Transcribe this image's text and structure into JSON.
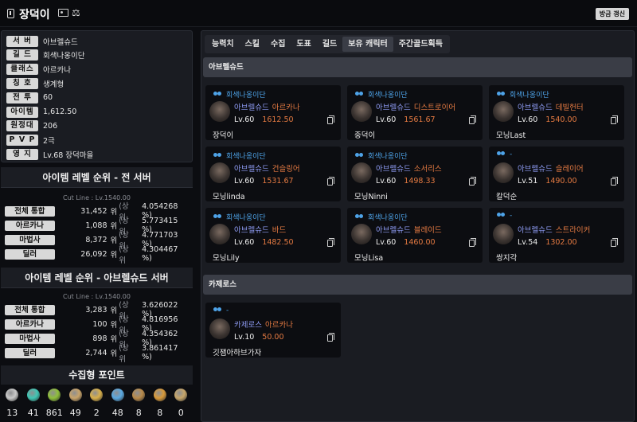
{
  "header": {
    "name": "장덕이",
    "refresh_label": "방금 갱신"
  },
  "info": [
    {
      "label": "서 버",
      "value": "아브렐슈드"
    },
    {
      "label": "길 드",
      "value": "회색나옹이단"
    },
    {
      "label": "클래스",
      "value": "아르카나"
    },
    {
      "label": "칭 호",
      "value": "생계형"
    },
    {
      "label": "전 투",
      "value": "60"
    },
    {
      "label": "아이템",
      "value": "1,612.50"
    },
    {
      "label": "원정대",
      "value": "206"
    },
    {
      "label": "P V P",
      "value": "2극"
    },
    {
      "label": "영 지",
      "value": "Lv.68 장덕마을"
    }
  ],
  "rank_all": {
    "title": "아이템 레벨 순위 - 전 서버",
    "cutline": "Cut Line : Lv.1540.00",
    "rows": [
      {
        "label": "전체 통합",
        "num": "31,452",
        "unit": "위",
        "upper": "(상위",
        "pct": "4.054268 %)"
      },
      {
        "label": "아르카나",
        "num": "1,088",
        "unit": "위",
        "upper": "(상위",
        "pct": "5.773415 %)"
      },
      {
        "label": "마법사",
        "num": "8,372",
        "unit": "위",
        "upper": "(상위",
        "pct": "4.771703 %)"
      },
      {
        "label": "딜러",
        "num": "26,092",
        "unit": "위",
        "upper": "(상위",
        "pct": "4.304467 %)"
      }
    ]
  },
  "rank_server": {
    "title": "아이템 레벨 순위 - 아브렐슈드 서버",
    "cutline": "Cut Line : Lv.1540.00",
    "rows": [
      {
        "label": "전체 통합",
        "num": "3,283",
        "unit": "위",
        "upper": "(상위",
        "pct": "3.626022 %)"
      },
      {
        "label": "아르카나",
        "num": "100",
        "unit": "위",
        "upper": "(상위",
        "pct": "4.816956 %)"
      },
      {
        "label": "마법사",
        "num": "898",
        "unit": "위",
        "upper": "(상위",
        "pct": "4.354362 %)"
      },
      {
        "label": "딜러",
        "num": "2,744",
        "unit": "위",
        "upper": "(상위",
        "pct": "3.861417 %)"
      }
    ]
  },
  "collection": {
    "title": "수집형 포인트",
    "items": [
      {
        "icon": "giant-heart-icon",
        "count": "13",
        "color": "#c9c9c9"
      },
      {
        "icon": "island-heart-icon",
        "count": "41",
        "color": "#3fc7b5"
      },
      {
        "icon": "mokoko-seed-icon",
        "count": "861",
        "color": "#8fbf3a"
      },
      {
        "icon": "art-icon",
        "count": "49",
        "color": "#c9a46a"
      },
      {
        "icon": "voyage-icon",
        "count": "2",
        "color": "#d9b04a"
      },
      {
        "icon": "world-tree-leaf-icon",
        "count": "48",
        "color": "#5aa8e0"
      },
      {
        "icon": "ignea-token-icon",
        "count": "8",
        "color": "#b88a4a"
      },
      {
        "icon": "orpheus-star-icon",
        "count": "8",
        "color": "#d99a3a"
      },
      {
        "icon": "orgel-icon",
        "count": "0",
        "color": "#c7a66a"
      }
    ]
  },
  "tabs": [
    {
      "label": "능력치",
      "active": false
    },
    {
      "label": "스킬",
      "active": false
    },
    {
      "label": "수집",
      "active": false
    },
    {
      "label": "도표",
      "active": false
    },
    {
      "label": "길드",
      "active": false
    },
    {
      "label": "보유 캐릭터",
      "active": true
    },
    {
      "label": "주간골드획득",
      "active": false
    }
  ],
  "groups": [
    {
      "name": "아브렐슈드",
      "characters": [
        {
          "guild": "회색나옹이단",
          "server": "아브렐슈드",
          "class": "아르카나",
          "level": "Lv.60",
          "ilvl": "1612.50",
          "name": "장덕이"
        },
        {
          "guild": "회색나옹이단",
          "server": "아브렐슈드",
          "class": "디스트로이어",
          "level": "Lv.60",
          "ilvl": "1561.67",
          "name": "중덕이"
        },
        {
          "guild": "회색나옹이단",
          "server": "아브렐슈드",
          "class": "데빌헌터",
          "level": "Lv.60",
          "ilvl": "1540.00",
          "name": "모닝Last"
        },
        {
          "guild": "회색나옹이단",
          "server": "아브렐슈드",
          "class": "건슬링어",
          "level": "Lv.60",
          "ilvl": "1531.67",
          "name": "모닝linda"
        },
        {
          "guild": "회색나옹이단",
          "server": "아브렐슈드",
          "class": "소서리스",
          "level": "Lv.60",
          "ilvl": "1498.33",
          "name": "모닝Ninni"
        },
        {
          "guild": "-",
          "server": "아브렐슈드",
          "class": "슬레이어",
          "level": "Lv.51",
          "ilvl": "1490.00",
          "name": "칼덕순"
        },
        {
          "guild": "회색나옹이단",
          "server": "아브렐슈드",
          "class": "바드",
          "level": "Lv.60",
          "ilvl": "1482.50",
          "name": "모닝Lily"
        },
        {
          "guild": "회색나옹이단",
          "server": "아브렐슈드",
          "class": "블레이드",
          "level": "Lv.60",
          "ilvl": "1460.00",
          "name": "모닝Lisa"
        },
        {
          "guild": "-",
          "server": "아브렐슈드",
          "class": "스트라이커",
          "level": "Lv.54",
          "ilvl": "1302.00",
          "name": "쌍지각"
        }
      ]
    },
    {
      "name": "카제로스",
      "characters": [
        {
          "guild": "-",
          "server": "카제로스",
          "class": "아르카나",
          "level": "Lv.10",
          "ilvl": "50.00",
          "name": "깃잼아하브가자"
        }
      ]
    }
  ]
}
